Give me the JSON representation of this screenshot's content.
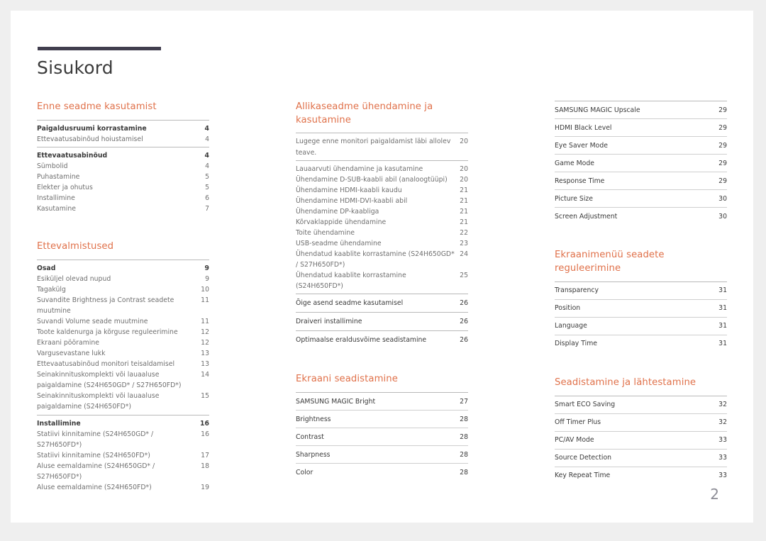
{
  "document": {
    "title": "Sisukord",
    "page_number": "2",
    "accent_color": "#e0714a",
    "rule_color": "#413e4e",
    "text_color": "#3a3a3a",
    "subtext_color": "#6f6f6f"
  },
  "columns": [
    {
      "name": "column-left",
      "sections": [
        {
          "title": "Enne seadme kasutamist",
          "groups": [
            {
              "style": "plain",
              "entries": [
                {
                  "label": "Paigaldusruumi korrastamine",
                  "page": "4",
                  "level": "top"
                },
                {
                  "label": "Ettevaatusabinõud hoiustamisel",
                  "page": "4",
                  "level": "sub"
                }
              ]
            },
            {
              "style": "plain",
              "entries": [
                {
                  "label": "Ettevaatusabinõud",
                  "page": "4",
                  "level": "top"
                },
                {
                  "label": "Sümbolid",
                  "page": "4",
                  "level": "sub"
                },
                {
                  "label": "Puhastamine",
                  "page": "5",
                  "level": "sub"
                },
                {
                  "label": "Elekter ja ohutus",
                  "page": "5",
                  "level": "sub"
                },
                {
                  "label": "Installimine",
                  "page": "6",
                  "level": "sub"
                },
                {
                  "label": "Kasutamine",
                  "page": "7",
                  "level": "sub"
                }
              ]
            }
          ]
        },
        {
          "title": "Ettevalmistused",
          "groups": [
            {
              "style": "plain",
              "entries": [
                {
                  "label": "Osad",
                  "page": "9",
                  "level": "top"
                },
                {
                  "label": "Esiküljel olevad nupud",
                  "page": "9",
                  "level": "sub"
                },
                {
                  "label": "Tagakülg",
                  "page": "10",
                  "level": "sub"
                },
                {
                  "label": "Suvandite Brightness ja Contrast seadete muutmine",
                  "page": "11",
                  "level": "sub",
                  "wrap": true
                },
                {
                  "label": "Suvandi Volume seade muutmine",
                  "page": "11",
                  "level": "sub"
                },
                {
                  "label": "Toote kaldenurga ja kõrguse reguleerimine",
                  "page": "12",
                  "level": "sub"
                },
                {
                  "label": "Ekraani pööramine",
                  "page": "12",
                  "level": "sub"
                },
                {
                  "label": "Vargusevastane lukk",
                  "page": "13",
                  "level": "sub"
                },
                {
                  "label": "Ettevaatusabinõud monitori teisaldamisel",
                  "page": "13",
                  "level": "sub"
                },
                {
                  "label": "Seinakinnituskomplekti või lauaaluse paigaldamine (S24H650GD* / S27H650FD*)",
                  "page": "14",
                  "level": "sub",
                  "wrap": true
                },
                {
                  "label": "Seinakinnituskomplekti või lauaaluse paigaldamine (S24H650FD*)",
                  "page": "15",
                  "level": "sub",
                  "wrap": true
                }
              ]
            },
            {
              "style": "plain",
              "entries": [
                {
                  "label": "Installimine",
                  "page": "16",
                  "level": "top"
                },
                {
                  "label": "Statiivi kinnitamine (S24H650GD* / S27H650FD*)",
                  "page": "16",
                  "level": "sub"
                },
                {
                  "label": "Statiivi kinnitamine (S24H650FD*)",
                  "page": "17",
                  "level": "sub"
                },
                {
                  "label": "Aluse eemaldamine (S24H650GD* / S27H650FD*)",
                  "page": "18",
                  "level": "sub"
                },
                {
                  "label": "Aluse eemaldamine (S24H650FD*)",
                  "page": "19",
                  "level": "sub"
                }
              ]
            }
          ]
        }
      ]
    },
    {
      "name": "column-middle",
      "sections": [
        {
          "title": "Allikaseadme ühendamine ja kasutamine",
          "groups": [
            {
              "style": "plain",
              "entries": [
                {
                  "label": "Lugege enne monitori paigaldamist läbi allolev teave.",
                  "page": "20",
                  "level": "top-normal",
                  "wrap": true
                }
              ]
            },
            {
              "style": "plain",
              "entries": [
                {
                  "label": "Lauaarvuti ühendamine ja kasutamine",
                  "page": "20",
                  "level": "top-normal"
                },
                {
                  "label": "Ühendamine D-SUB-kaabli abil (analoogtüüpi)",
                  "page": "20",
                  "level": "sub"
                },
                {
                  "label": "Ühendamine HDMI-kaabli kaudu",
                  "page": "21",
                  "level": "sub"
                },
                {
                  "label": "Ühendamine HDMI-DVI-kaabli abil",
                  "page": "21",
                  "level": "sub"
                },
                {
                  "label": "Ühendamine DP-kaabliga",
                  "page": "21",
                  "level": "sub"
                },
                {
                  "label": "Kõrvaklappide ühendamine",
                  "page": "21",
                  "level": "sub"
                },
                {
                  "label": "Toite ühendamine",
                  "page": "22",
                  "level": "sub"
                },
                {
                  "label": "USB-seadme ühendamine",
                  "page": "23",
                  "level": "sub"
                },
                {
                  "label": "Ühendatud kaablite korrastamine (S24H650GD* / S27H650FD*)",
                  "page": "24",
                  "level": "sub",
                  "wrap": true
                },
                {
                  "label": "Ühendatud kaablite korrastamine (S24H650FD*)",
                  "page": "25",
                  "level": "sub"
                }
              ]
            },
            {
              "style": "ruled",
              "entries": [
                {
                  "label": "Õige asend seadme kasutamisel",
                  "page": "26",
                  "level": "top-normal"
                }
              ]
            },
            {
              "style": "ruled",
              "entries": [
                {
                  "label": "Draiveri installimine",
                  "page": "26",
                  "level": "top-normal"
                }
              ]
            },
            {
              "style": "ruled",
              "entries": [
                {
                  "label": "Optimaalse eraldusvõime seadistamine",
                  "page": "26",
                  "level": "top-normal"
                }
              ]
            }
          ]
        },
        {
          "title": "Ekraani seadistamine",
          "groups": [
            {
              "style": "spaced",
              "entries": [
                {
                  "label": "SAMSUNG MAGIC Bright",
                  "page": "27",
                  "level": "top-normal"
                },
                {
                  "label": "Brightness",
                  "page": "28",
                  "level": "top-normal"
                },
                {
                  "label": "Contrast",
                  "page": "28",
                  "level": "top-normal"
                },
                {
                  "label": "Sharpness",
                  "page": "28",
                  "level": "top-normal"
                },
                {
                  "label": "Color",
                  "page": "28",
                  "level": "top-normal"
                }
              ]
            }
          ]
        }
      ]
    },
    {
      "name": "column-right",
      "sections": [
        {
          "title": "",
          "groups": [
            {
              "style": "spaced",
              "entries": [
                {
                  "label": "SAMSUNG MAGIC Upscale",
                  "page": "29",
                  "level": "top-normal"
                },
                {
                  "label": "HDMI Black Level",
                  "page": "29",
                  "level": "top-normal"
                },
                {
                  "label": "Eye Saver Mode",
                  "page": "29",
                  "level": "top-normal"
                },
                {
                  "label": "Game Mode",
                  "page": "29",
                  "level": "top-normal"
                },
                {
                  "label": "Response Time",
                  "page": "29",
                  "level": "top-normal"
                },
                {
                  "label": "Picture Size",
                  "page": "30",
                  "level": "top-normal"
                },
                {
                  "label": "Screen Adjustment",
                  "page": "30",
                  "level": "top-normal"
                }
              ]
            }
          ]
        },
        {
          "title": "Ekraanimenüü seadete reguleerimine",
          "groups": [
            {
              "style": "spaced",
              "entries": [
                {
                  "label": "Transparency",
                  "page": "31",
                  "level": "top-normal"
                },
                {
                  "label": "Position",
                  "page": "31",
                  "level": "top-normal"
                },
                {
                  "label": "Language",
                  "page": "31",
                  "level": "top-normal"
                },
                {
                  "label": "Display Time",
                  "page": "31",
                  "level": "top-normal"
                }
              ]
            }
          ]
        },
        {
          "title": "Seadistamine ja lähtestamine",
          "groups": [
            {
              "style": "spaced",
              "entries": [
                {
                  "label": "Smart ECO Saving",
                  "page": "32",
                  "level": "top-normal"
                },
                {
                  "label": "Off Timer Plus",
                  "page": "32",
                  "level": "top-normal"
                },
                {
                  "label": "PC/AV Mode",
                  "page": "33",
                  "level": "top-normal"
                },
                {
                  "label": "Source Detection",
                  "page": "33",
                  "level": "top-normal"
                },
                {
                  "label": "Key Repeat Time",
                  "page": "33",
                  "level": "top-normal"
                }
              ]
            }
          ]
        }
      ]
    }
  ]
}
